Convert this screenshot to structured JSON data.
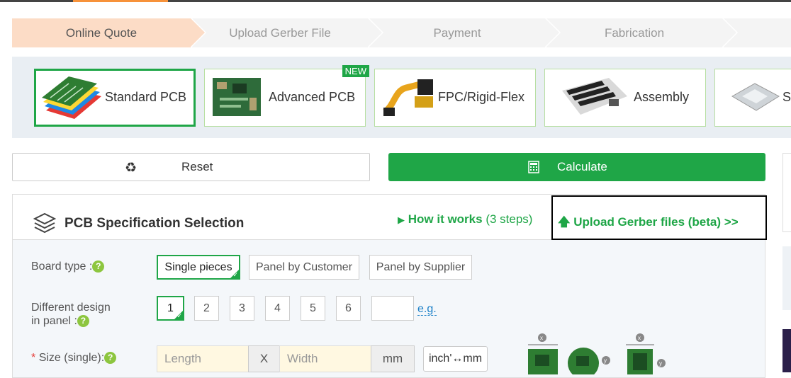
{
  "steps": [
    "Online Quote",
    "Upload Gerber File",
    "Payment",
    "Fabrication"
  ],
  "products": [
    {
      "label": "Standard PCB",
      "icon": "standard-pcb-image"
    },
    {
      "label": "Advanced PCB",
      "icon": "advanced-pcb-image",
      "badge": "NEW"
    },
    {
      "label": "FPC/Rigid-Flex",
      "icon": "fpc-image"
    },
    {
      "label": "Assembly",
      "icon": "assembly-image"
    },
    {
      "label": "S",
      "icon": "stencil-image"
    }
  ],
  "actions": {
    "reset": "Reset",
    "calculate": "Calculate"
  },
  "spec": {
    "title": "PCB Specification Selection",
    "how_it_works": "How it works",
    "steps_note": "(3 steps)",
    "upload_link": "Upload Gerber files (beta) >>"
  },
  "board_type": {
    "label": "Board type :",
    "options": [
      "Single pieces",
      "Panel by Customer",
      "Panel by Supplier"
    ],
    "selected": "Single pieces"
  },
  "different_design": {
    "label_line1": "Different design",
    "label_line2": "in panel :",
    "options": [
      "1",
      "2",
      "3",
      "4",
      "5",
      "6"
    ],
    "selected": "1",
    "eg": "e.g."
  },
  "size": {
    "required_mark": "*",
    "label": "Size (single):",
    "length_placeholder": "Length",
    "x": "X",
    "width_placeholder": "Width",
    "unit": "mm",
    "convert": "inch'↔mm"
  },
  "colors": {
    "green": "#1fa647",
    "orange": "#f7923a",
    "step_active": "#fcdcc6"
  }
}
